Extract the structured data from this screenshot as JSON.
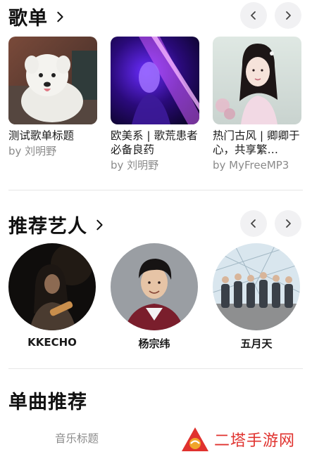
{
  "playlists_section": {
    "title": "歌单",
    "items": [
      {
        "title": "测试歌单标题",
        "author": "by 刘明野"
      },
      {
        "title": "欧美系 | 歌荒患者必备良药",
        "author": "by 刘明野"
      },
      {
        "title": "热门古风 | 卿卿于心，共享繁…",
        "author": "by MyFreeMP3"
      }
    ]
  },
  "artists_section": {
    "title": "推荐艺人",
    "items": [
      {
        "name": "KKECHO"
      },
      {
        "name": "杨宗纬"
      },
      {
        "name": "五月天"
      }
    ]
  },
  "songs_section": {
    "title": "单曲推荐",
    "first_song_title": "音乐标题"
  },
  "watermark": {
    "text": "二塔手游网"
  },
  "colors": {
    "nav_button_bg": "#f1f1f3",
    "watermark": "#e0322e",
    "muted_text": "#8a8a8a"
  },
  "icons": {
    "section_more": "chevron-right-icon",
    "prev": "chevron-left-icon",
    "next": "chevron-right-icon"
  }
}
